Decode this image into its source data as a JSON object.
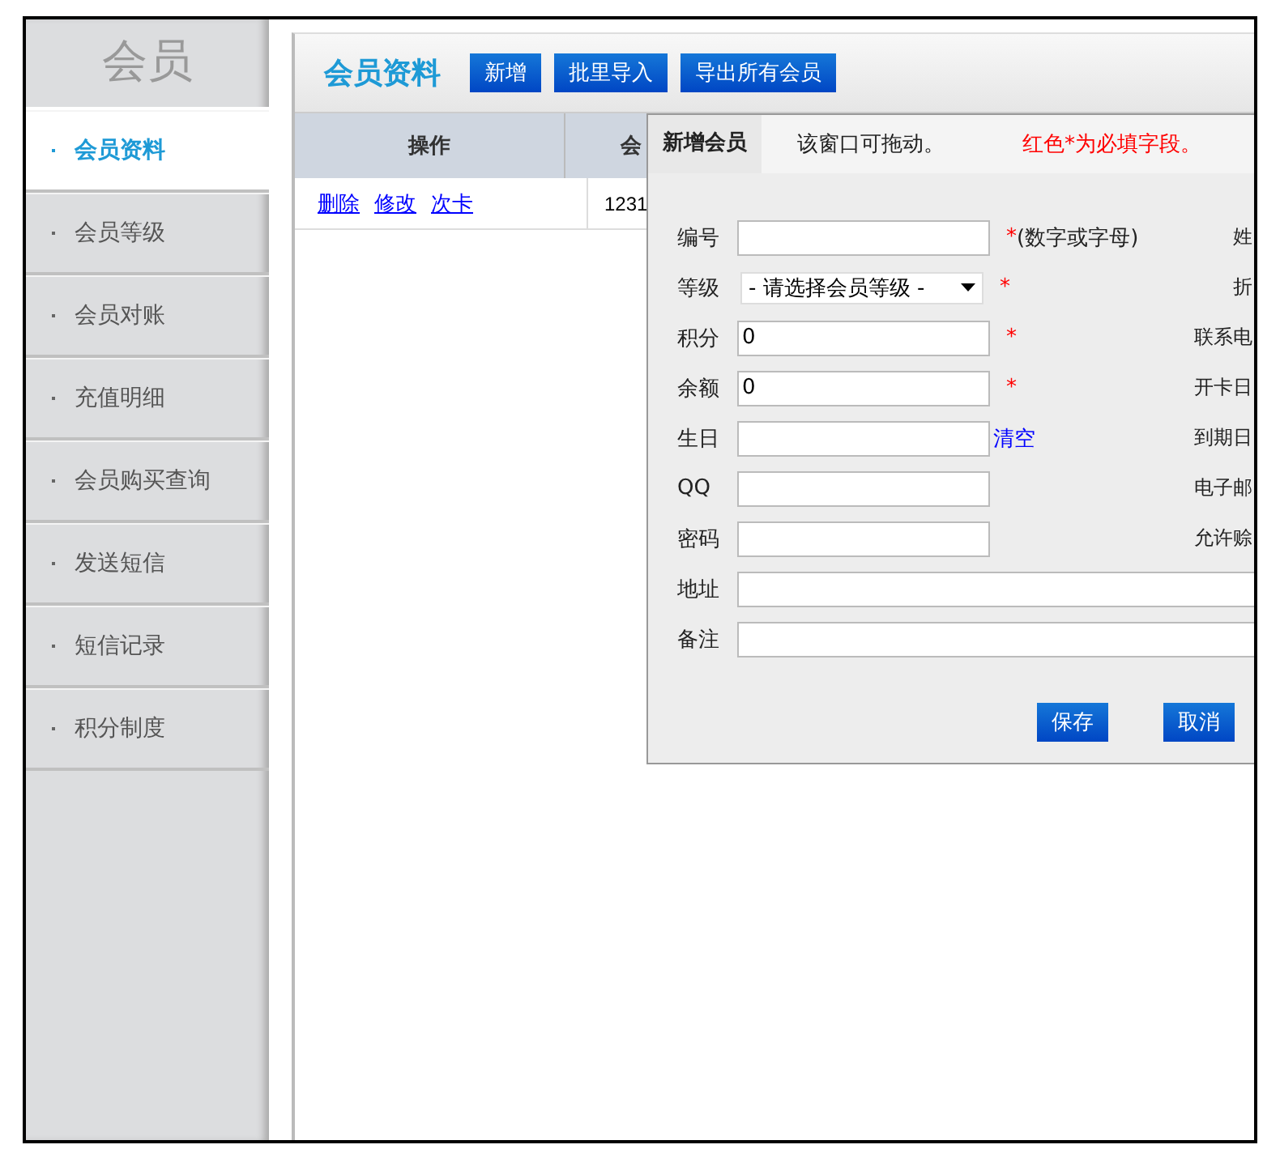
{
  "sidebar": {
    "title": "会员",
    "items": [
      {
        "label": "会员资料",
        "selected": true
      },
      {
        "label": "会员等级",
        "selected": false
      },
      {
        "label": "会员对账",
        "selected": false
      },
      {
        "label": "充值明细",
        "selected": false
      },
      {
        "label": "会员购买查询",
        "selected": false
      },
      {
        "label": "发送短信",
        "selected": false
      },
      {
        "label": "短信记录",
        "selected": false
      },
      {
        "label": "积分制度",
        "selected": false
      }
    ]
  },
  "header": {
    "title": "会员资料",
    "buttons": [
      "新增",
      "批里导入",
      "导出所有会员"
    ]
  },
  "table": {
    "columns": [
      "操作",
      "会"
    ],
    "rows": [
      {
        "actions": [
          "删除",
          "修改",
          "次卡"
        ],
        "column_2": "1231"
      }
    ]
  },
  "dialog": {
    "title": "新增会员",
    "hint": "该窗口可拖动。",
    "required_hint": "红色*为必填字段。",
    "fields": [
      {
        "label": "编号",
        "kind": "input",
        "required_mark": "*",
        "note": "(数字或字母)",
        "right_label": "姓"
      },
      {
        "label": "等级",
        "kind": "select",
        "value": "- 请选择会员等级 -",
        "required_mark": "*",
        "right_label": "折"
      },
      {
        "label": "积分",
        "kind": "input",
        "value": "0",
        "required_mark": "*",
        "right_label": "联系电"
      },
      {
        "label": "余额",
        "kind": "input",
        "value": "0",
        "required_mark": "*",
        "right_label": "开卡日"
      },
      {
        "label": "生日",
        "kind": "input",
        "link": "清空",
        "right_label": "到期日"
      },
      {
        "label": "QQ",
        "kind": "input",
        "right_label": "电子邮"
      },
      {
        "label": "密码",
        "kind": "input",
        "right_label": "允许赊"
      },
      {
        "label": "地址",
        "kind": "wide"
      },
      {
        "label": "备注",
        "kind": "wide"
      }
    ],
    "buttons": [
      "保存",
      "取消"
    ]
  }
}
